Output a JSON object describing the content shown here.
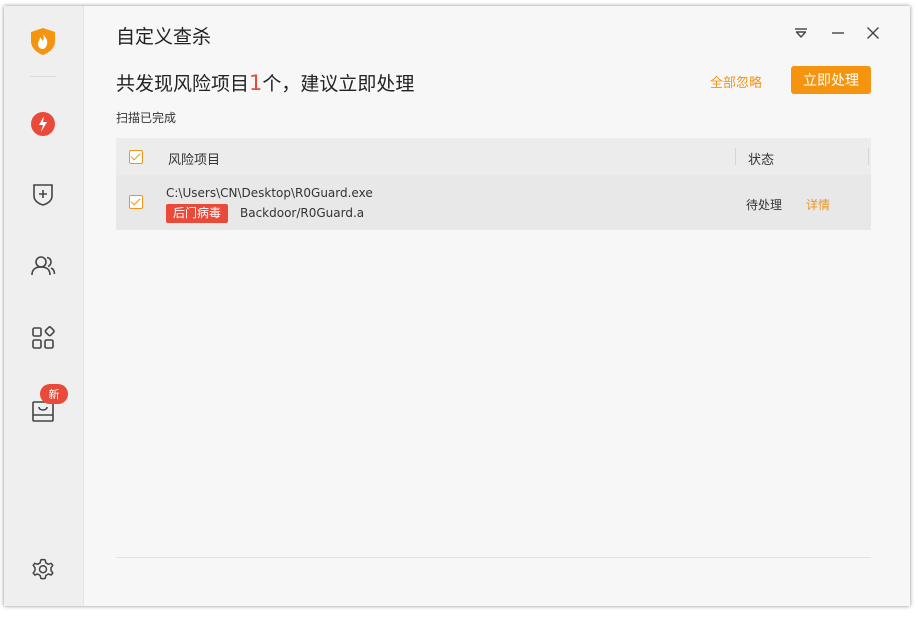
{
  "window": {
    "title": "自定义查杀"
  },
  "header": {
    "headline_prefix": "共发现风险项目",
    "headline_count": "1",
    "headline_suffix": "个，建议立即处理",
    "ignore_all_label": "全部忽略",
    "handle_now_label": "立即处理",
    "scan_status": "扫描已完成"
  },
  "sidebar": {
    "items": [
      {
        "icon": "flame-logo-icon"
      },
      {
        "icon": "speed-icon"
      },
      {
        "icon": "shield-plus-icon"
      },
      {
        "icon": "users-icon"
      },
      {
        "icon": "apps-grid-icon"
      },
      {
        "icon": "box-icon",
        "badge": "新"
      },
      {
        "icon": "gear-icon"
      }
    ]
  },
  "table": {
    "columns": [
      "风险项目",
      "状态"
    ],
    "rows": [
      {
        "path": "C:\\Users\\CN\\Desktop\\R0Guard.exe",
        "tag": "后门病毒",
        "virus_name": "Backdoor/R0Guard.a",
        "status": "待处理",
        "action": "详情"
      }
    ]
  },
  "colors": {
    "accent": "#f5940f",
    "danger": "#e94a3a"
  }
}
